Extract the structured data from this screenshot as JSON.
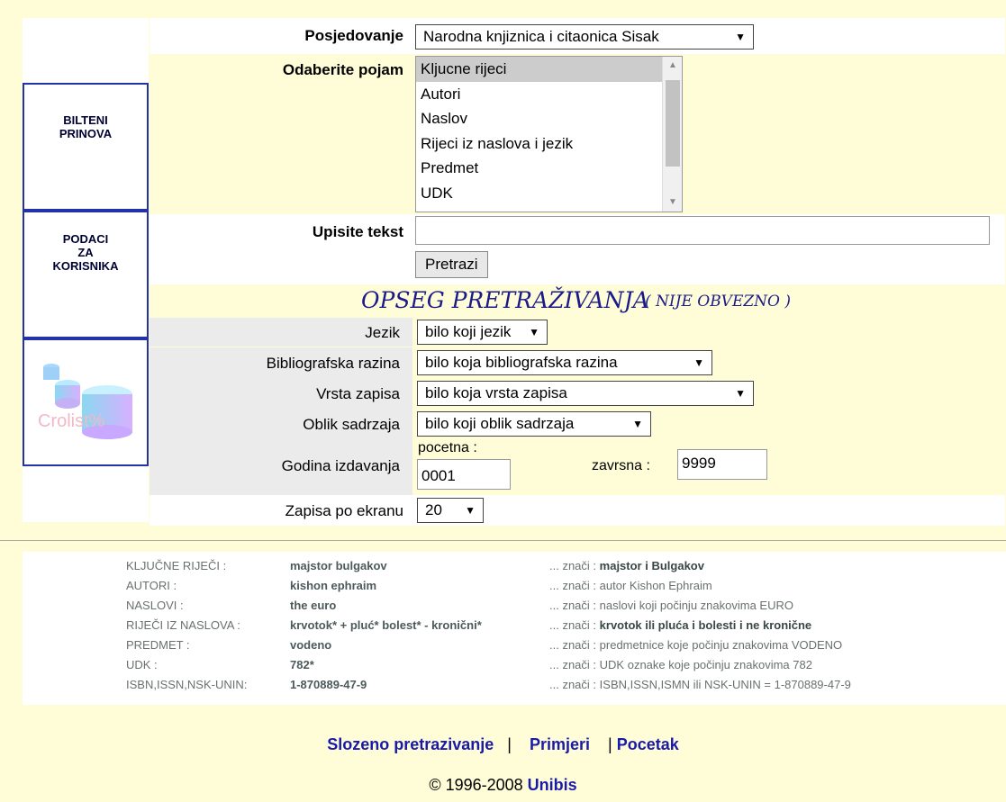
{
  "sidebar": {
    "box1_line1": "BILTENI",
    "box1_line2": "PRINOVA",
    "box2_line1": "PODACI",
    "box2_line2": "ZA",
    "box2_line3": "KORISNIKA",
    "logo_text": "Crolist%"
  },
  "form": {
    "posjedovanje_label": "Posjedovanje",
    "posjedovanje_value": "Narodna knjiznica i citaonica Sisak",
    "pojam_label": "Odaberite pojam",
    "pojam_options": [
      "Kljucne rijeci",
      "Autori",
      "Naslov",
      "Rijeci iz naslova i jezik",
      "Predmet",
      "UDK"
    ],
    "tekst_label": "Upisite tekst",
    "tekst_value": "",
    "search_button": "Pretrazi",
    "opseg_title": "OPSEG PRETRAŽIVANJA",
    "opseg_note": "( NIJE OBVEZNO )",
    "jezik_label": "Jezik",
    "jezik_value": "bilo koji jezik",
    "razina_label": "Bibliografska razina",
    "razina_value": "bilo koja bibliografska razina",
    "vrsta_label": "Vrsta zapisa",
    "vrsta_value": "bilo koja vrsta zapisa",
    "oblik_label": "Oblik sadrzaja",
    "oblik_value": "bilo koji oblik sadrzaja",
    "godina_label": "Godina izdavanja",
    "pocetna_label": "pocetna :",
    "pocetna_value": "0001",
    "zavrsna_label": "zavrsna :",
    "zavrsna_value": "9999",
    "zapisa_label": "Zapisa po ekranu",
    "zapisa_value": "20"
  },
  "examples": [
    {
      "key": "KLJUČNE RIJEČI :",
      "value": "majstor bulgakov",
      "means_prefix": "... znači :",
      "means": "majstor i Bulgakov"
    },
    {
      "key": "AUTORI :",
      "value": "kishon ephraim",
      "means_prefix": "... znači :",
      "means": "autor Kishon Ephraim"
    },
    {
      "key": "NASLOVI :",
      "value": "the euro",
      "means_prefix": "... znači :",
      "means": "naslovi koji počinju znakovima EURO"
    },
    {
      "key": "RIJEČI IZ NASLOVA :",
      "value": "krvotok* + pluć* bolest* - kronični*",
      "means_prefix": "... znači :",
      "means": "krvotok ili pluća i bolesti i ne kronične"
    },
    {
      "key": "PREDMET :",
      "value": "vodeno",
      "means_prefix": "... znači :",
      "means": "predmetnice koje počinju znakovima VODENO"
    },
    {
      "key": "UDK :",
      "value": "782*",
      "means_prefix": "... znači :",
      "means": "UDK oznake koje počinju znakovima 782"
    },
    {
      "key": "ISBN,ISSN,NSK-UNIN:",
      "value": "1-870889-47-9",
      "means_prefix": "... znači :",
      "means": "ISBN,ISSN,ISMN ili NSK-UNIN = 1-870889-47-9"
    }
  ],
  "footer": {
    "link1": "Slozeno pretrazivanje",
    "sep": "|",
    "link2": "Primjeri",
    "link3": "Pocetak",
    "copyright": "© 1996-2008",
    "brand": "Unibis"
  }
}
